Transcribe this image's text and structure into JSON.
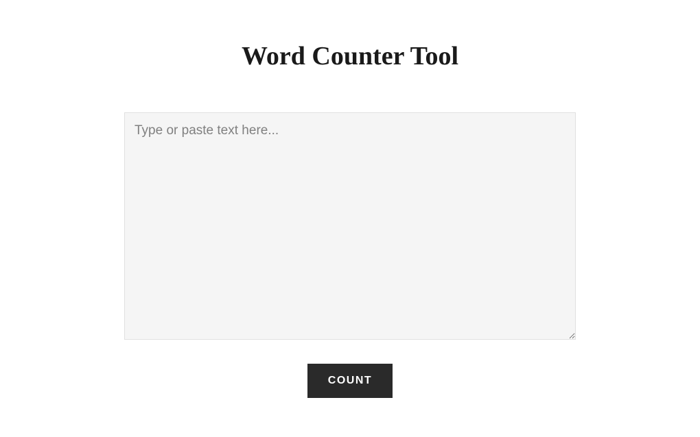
{
  "header": {
    "title": "Word Counter Tool"
  },
  "main": {
    "textarea": {
      "placeholder": "Type or paste text here...",
      "value": ""
    },
    "count_button_label": "COUNT"
  }
}
